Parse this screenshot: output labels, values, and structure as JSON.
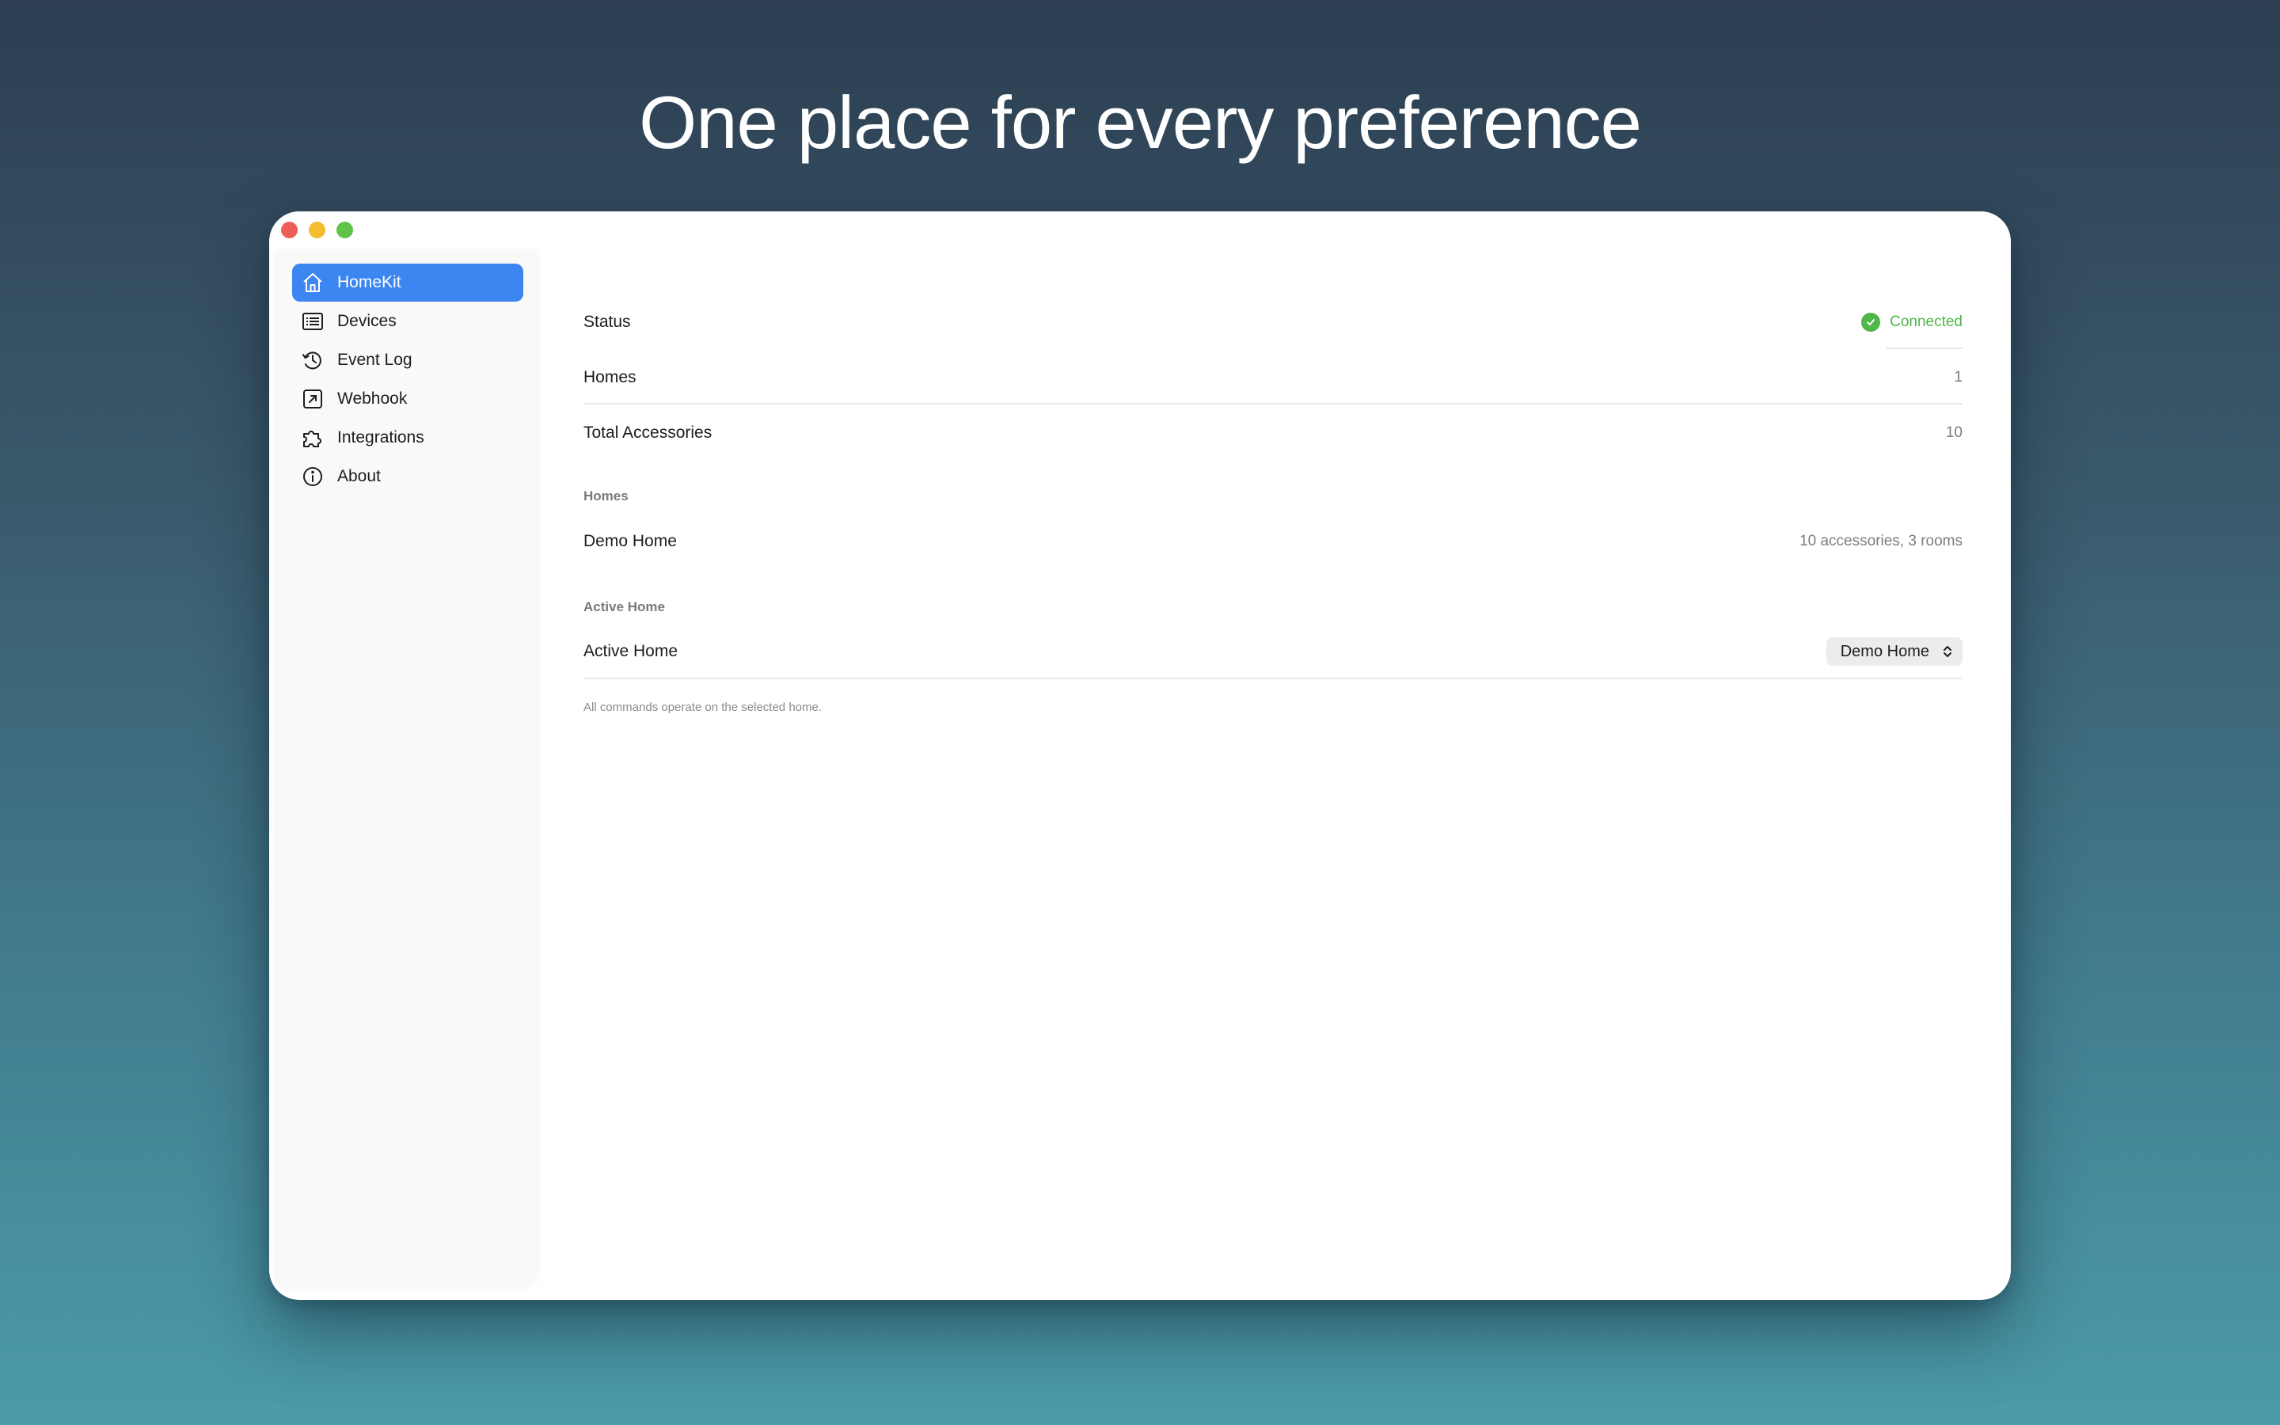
{
  "headline": "One place for every preference",
  "sidebar": {
    "items": [
      {
        "label": "HomeKit",
        "icon": "house-icon",
        "active": true
      },
      {
        "label": "Devices",
        "icon": "list-icon",
        "active": false
      },
      {
        "label": "Event Log",
        "icon": "history-clock-icon",
        "active": false
      },
      {
        "label": "Webhook",
        "icon": "arrow-up-right-square-icon",
        "active": false
      },
      {
        "label": "Integrations",
        "icon": "puzzle-icon",
        "active": false
      },
      {
        "label": "About",
        "icon": "info-circle-icon",
        "active": false
      }
    ]
  },
  "main": {
    "status": {
      "label": "Status",
      "value": "Connected",
      "icon": "checkmark-circle-icon"
    },
    "homes_count": {
      "label": "Homes",
      "value": "1"
    },
    "total_accessories": {
      "label": "Total Accessories",
      "value": "10"
    },
    "homes_section": {
      "header": "Homes",
      "items": [
        {
          "name": "Demo Home",
          "detail": "10 accessories, 3 rooms"
        }
      ]
    },
    "active_home_section": {
      "header": "Active Home",
      "label": "Active Home",
      "selected": "Demo Home",
      "footnote": "All commands operate on the selected home."
    }
  },
  "colors": {
    "accent": "#3b86f0",
    "connected": "#4fb648",
    "close": "#ee5e58",
    "minimize": "#f4bd2e",
    "maximize": "#5fc34a"
  }
}
